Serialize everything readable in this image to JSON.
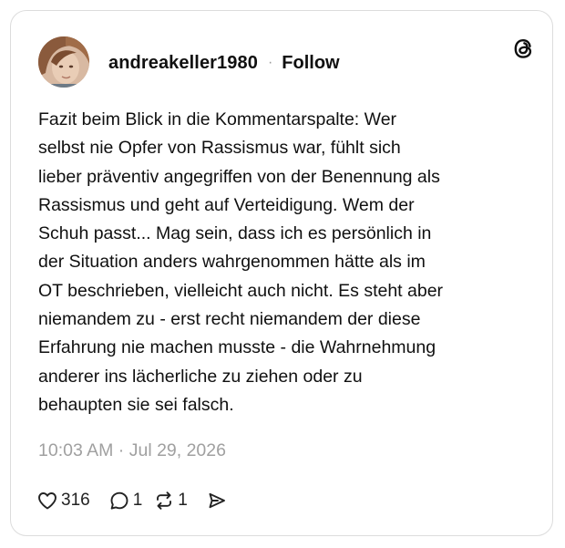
{
  "post": {
    "username": "andreakeller1980",
    "separator": "·",
    "follow_label": "Follow",
    "text": "Fazit beim Blick in die Kommentarspalte: Wer\nselbst nie Opfer von Rassismus war, fühlt sich\nlieber präventiv angegriffen von der Benennung als\nRassismus und geht auf Verteidigung. Wem der\nSchuh passt... Mag sein, dass ich es persönlich in\nder Situation anders wahrgenommen hätte als im\nOT beschrieben, vielleicht auch nicht. Es steht aber\nniemandem zu - erst recht niemandem der diese\nErfahrung nie machen musste - die Wahrnehmung\nanderer ins lächerliche zu ziehen oder zu\nbehaupten sie sei falsch.",
    "timestamp": "10:03 AM · Jul 29, 2026"
  },
  "actions": {
    "likes": "316",
    "replies": "1",
    "reposts": "1"
  },
  "icons": {
    "brand": "threads-logo-icon",
    "like": "heart-icon",
    "reply": "comment-bubble-icon",
    "repost": "repost-icon",
    "share": "send-icon"
  },
  "colors": {
    "text": "#101010",
    "muted": "#a0a0a0",
    "border": "#dcdcdc"
  }
}
